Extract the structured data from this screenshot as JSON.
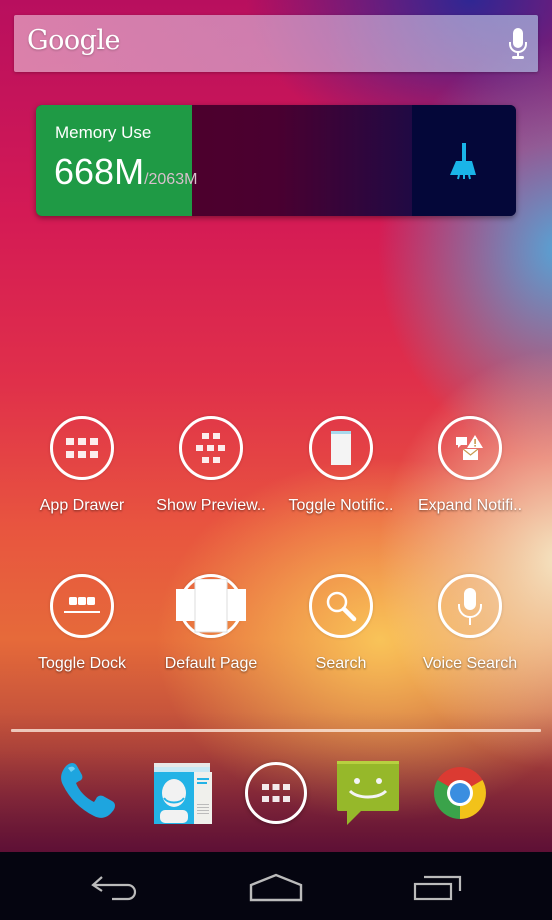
{
  "search_bar": {
    "logo_text": "Google",
    "mic_icon": "mic-icon"
  },
  "memory_widget": {
    "title": "Memory Use",
    "used": "668M",
    "total": "/2063M",
    "used_fraction": 0.324,
    "fill_color": "#1f9a45",
    "clean_icon": "broom-icon",
    "accent_color": "#1ab4e8"
  },
  "shortcuts": [
    {
      "label": "App Drawer",
      "icon": "app-drawer-icon"
    },
    {
      "label": "Show Preview..",
      "icon": "show-preview-icon"
    },
    {
      "label": "Toggle Notific..",
      "icon": "toggle-notification-icon"
    },
    {
      "label": "Expand Notifi..",
      "icon": "expand-notification-icon"
    },
    {
      "label": "Toggle Dock",
      "icon": "toggle-dock-icon"
    },
    {
      "label": "Default Page",
      "icon": "default-page-icon"
    },
    {
      "label": "Search",
      "icon": "search-icon"
    },
    {
      "label": "Voice Search",
      "icon": "voice-search-icon"
    }
  ],
  "dock": [
    {
      "name": "Phone",
      "icon": "phone-icon"
    },
    {
      "name": "People",
      "icon": "contacts-icon"
    },
    {
      "name": "All Apps",
      "icon": "app-drawer-icon"
    },
    {
      "name": "Messaging",
      "icon": "messaging-icon"
    },
    {
      "name": "Chrome",
      "icon": "chrome-icon"
    }
  ],
  "nav_bar": {
    "back": "back-icon",
    "home": "home-icon",
    "recents": "recents-icon"
  }
}
